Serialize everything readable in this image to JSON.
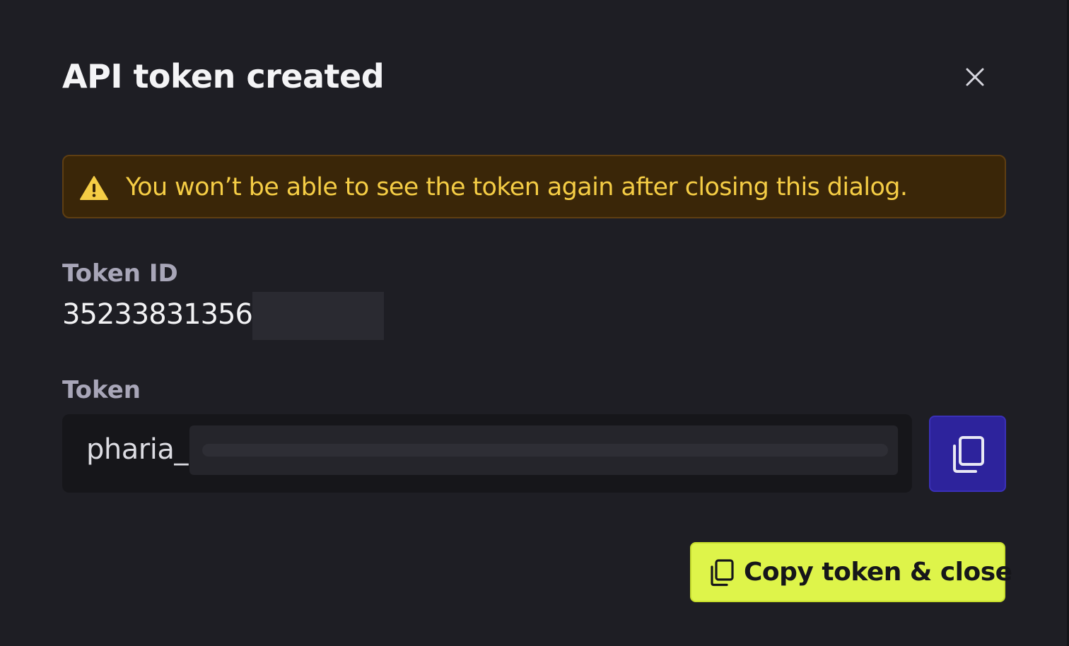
{
  "dialog": {
    "title": "API token created",
    "close_icon": "close-icon"
  },
  "warning": {
    "icon": "warning-icon",
    "text": "You won’t be able to see the token again after closing this dialog.",
    "text_color": "#f5cd45",
    "background": "#3a2608"
  },
  "token_id": {
    "label": "Token ID",
    "value_visible": "35233831356"
  },
  "token": {
    "label": "Token",
    "value_visible": "pharia_"
  },
  "copy_icon_button": {
    "icon": "copy-icon",
    "color": "#2d239c"
  },
  "primary_button": {
    "icon": "copy-icon",
    "label": "Copy token & close",
    "color": "#def44a"
  }
}
